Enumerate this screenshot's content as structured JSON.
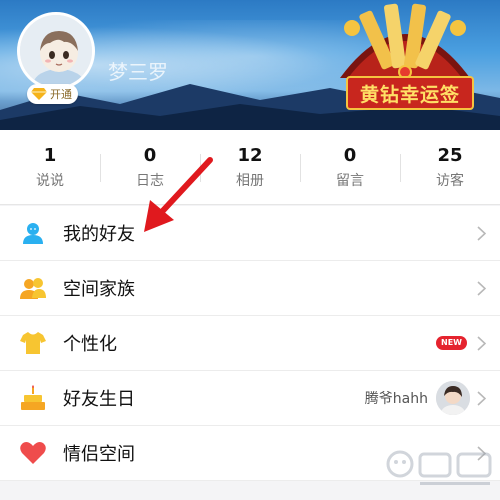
{
  "profile": {
    "username": "梦三罗",
    "vip_badge_label": "开通"
  },
  "promo": {
    "text": "黄钻幸运签"
  },
  "stats": [
    {
      "count": "1",
      "label": "说说"
    },
    {
      "count": "0",
      "label": "日志"
    },
    {
      "count": "12",
      "label": "相册"
    },
    {
      "count": "0",
      "label": "留言"
    },
    {
      "count": "25",
      "label": "访客"
    }
  ],
  "menu": {
    "items": [
      {
        "label": "我的好友",
        "icon": "person-icon",
        "color": "#2ab0f0"
      },
      {
        "label": "空间家族",
        "icon": "people-icon",
        "color": "#f5a623"
      },
      {
        "label": "个性化",
        "icon": "tshirt-icon",
        "color": "#f7c531"
      },
      {
        "label": "好友生日",
        "icon": "cake-icon",
        "color": "#f5a623"
      },
      {
        "label": "情侣空间",
        "icon": "heart-icon",
        "color": "#ef4c4c"
      }
    ],
    "new_badge": "NEW",
    "birthday_friend_name": "腾爷hahh"
  },
  "colors": {
    "annotation_arrow": "#e0191e",
    "new_badge": "#e5232e"
  }
}
